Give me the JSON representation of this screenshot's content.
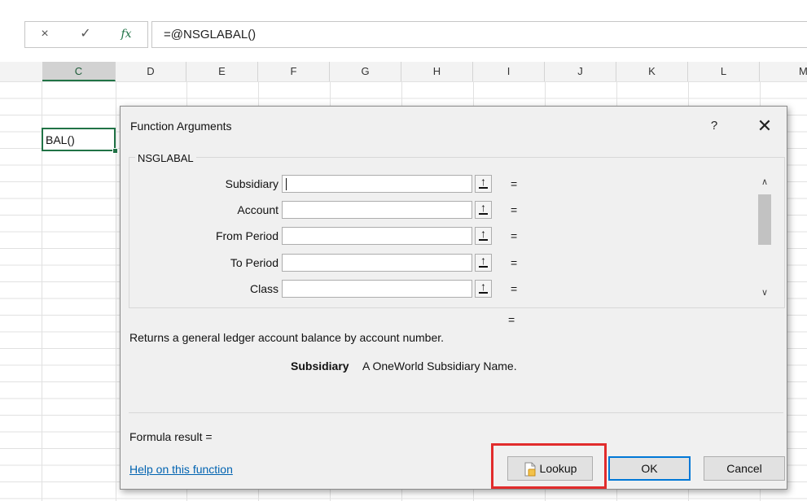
{
  "formula_bar": {
    "cancel_icon": "×",
    "enter_icon": "✓",
    "fx_label": "fx",
    "formula": "=@NSGLABAL()"
  },
  "columns": [
    "C",
    "D",
    "E",
    "F",
    "G",
    "H",
    "I",
    "J",
    "K",
    "L",
    "M"
  ],
  "active_cell": {
    "column": "C",
    "value": "BAL()"
  },
  "dialog": {
    "title": "Function Arguments",
    "help_label": "?",
    "close_label": "✕",
    "function_name": "NSGLABAL",
    "arguments": [
      {
        "label": "Subsidiary",
        "value": "",
        "result": "="
      },
      {
        "label": "Account",
        "value": "",
        "result": "="
      },
      {
        "label": "From Period",
        "value": "",
        "result": "="
      },
      {
        "label": "To Period",
        "value": "",
        "result": "="
      },
      {
        "label": "Class",
        "value": "",
        "result": "="
      }
    ],
    "result_equals": "=",
    "description": "Returns a general ledger account balance by account number.",
    "param_name": "Subsidiary",
    "param_description": "A OneWorld Subsidiary Name.",
    "formula_result": "Formula result =",
    "help_link": "Help on this function",
    "buttons": {
      "lookup": "Lookup",
      "ok": "OK",
      "cancel": "Cancel"
    }
  },
  "colors": {
    "excel_green": "#217346",
    "highlight_red": "#e12c2c",
    "ok_border": "#0078d7",
    "link_blue": "#0063b1"
  }
}
